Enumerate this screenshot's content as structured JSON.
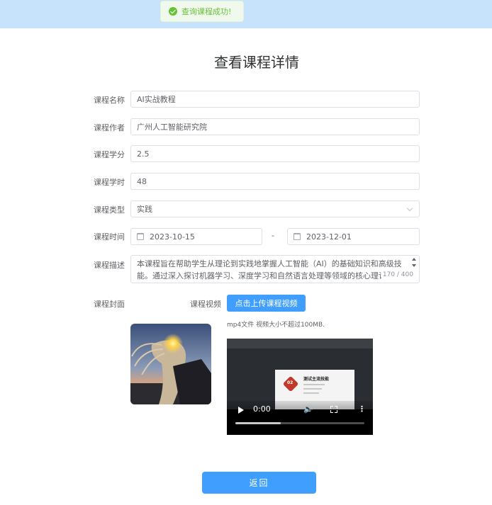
{
  "toast": {
    "icon": "check-circle-icon",
    "text": "查询课程成功!"
  },
  "page_title": "查看课程详情",
  "form": {
    "name": {
      "label": "课程名称",
      "value": "AI实战教程"
    },
    "author": {
      "label": "课程作者",
      "value": "广州人工智能研究院"
    },
    "credit": {
      "label": "课程学分",
      "value": "2.5"
    },
    "hours": {
      "label": "课程学时",
      "value": "48"
    },
    "type": {
      "label": "课程类型",
      "value": "实践"
    },
    "time": {
      "label": "课程时间",
      "start": "2023-10-15",
      "separator": "-",
      "end": "2023-12-01"
    },
    "description": {
      "label": "课程描述",
      "value": "本课程旨在帮助学生从理论到实践地掌握人工智能（AI）的基础知识和高级技能。通过深入探讨机器学习、深度学习和自然语言处理等领域的核心理论，",
      "counter": "170 / 400"
    },
    "cover": {
      "label": "课程封面"
    },
    "video": {
      "label": "课程视频",
      "upload_button": "点击上传课程视频",
      "tip": "mp4文件 视频大小不超过100MB.",
      "slide_badge": "02",
      "slide_title": "测试主流技能",
      "time": "0:00",
      "progress": 0.35
    }
  },
  "back_button": "返回",
  "colors": {
    "primary": "#409eff",
    "success": "#67c23a",
    "topbar": "#c7e3fb"
  }
}
